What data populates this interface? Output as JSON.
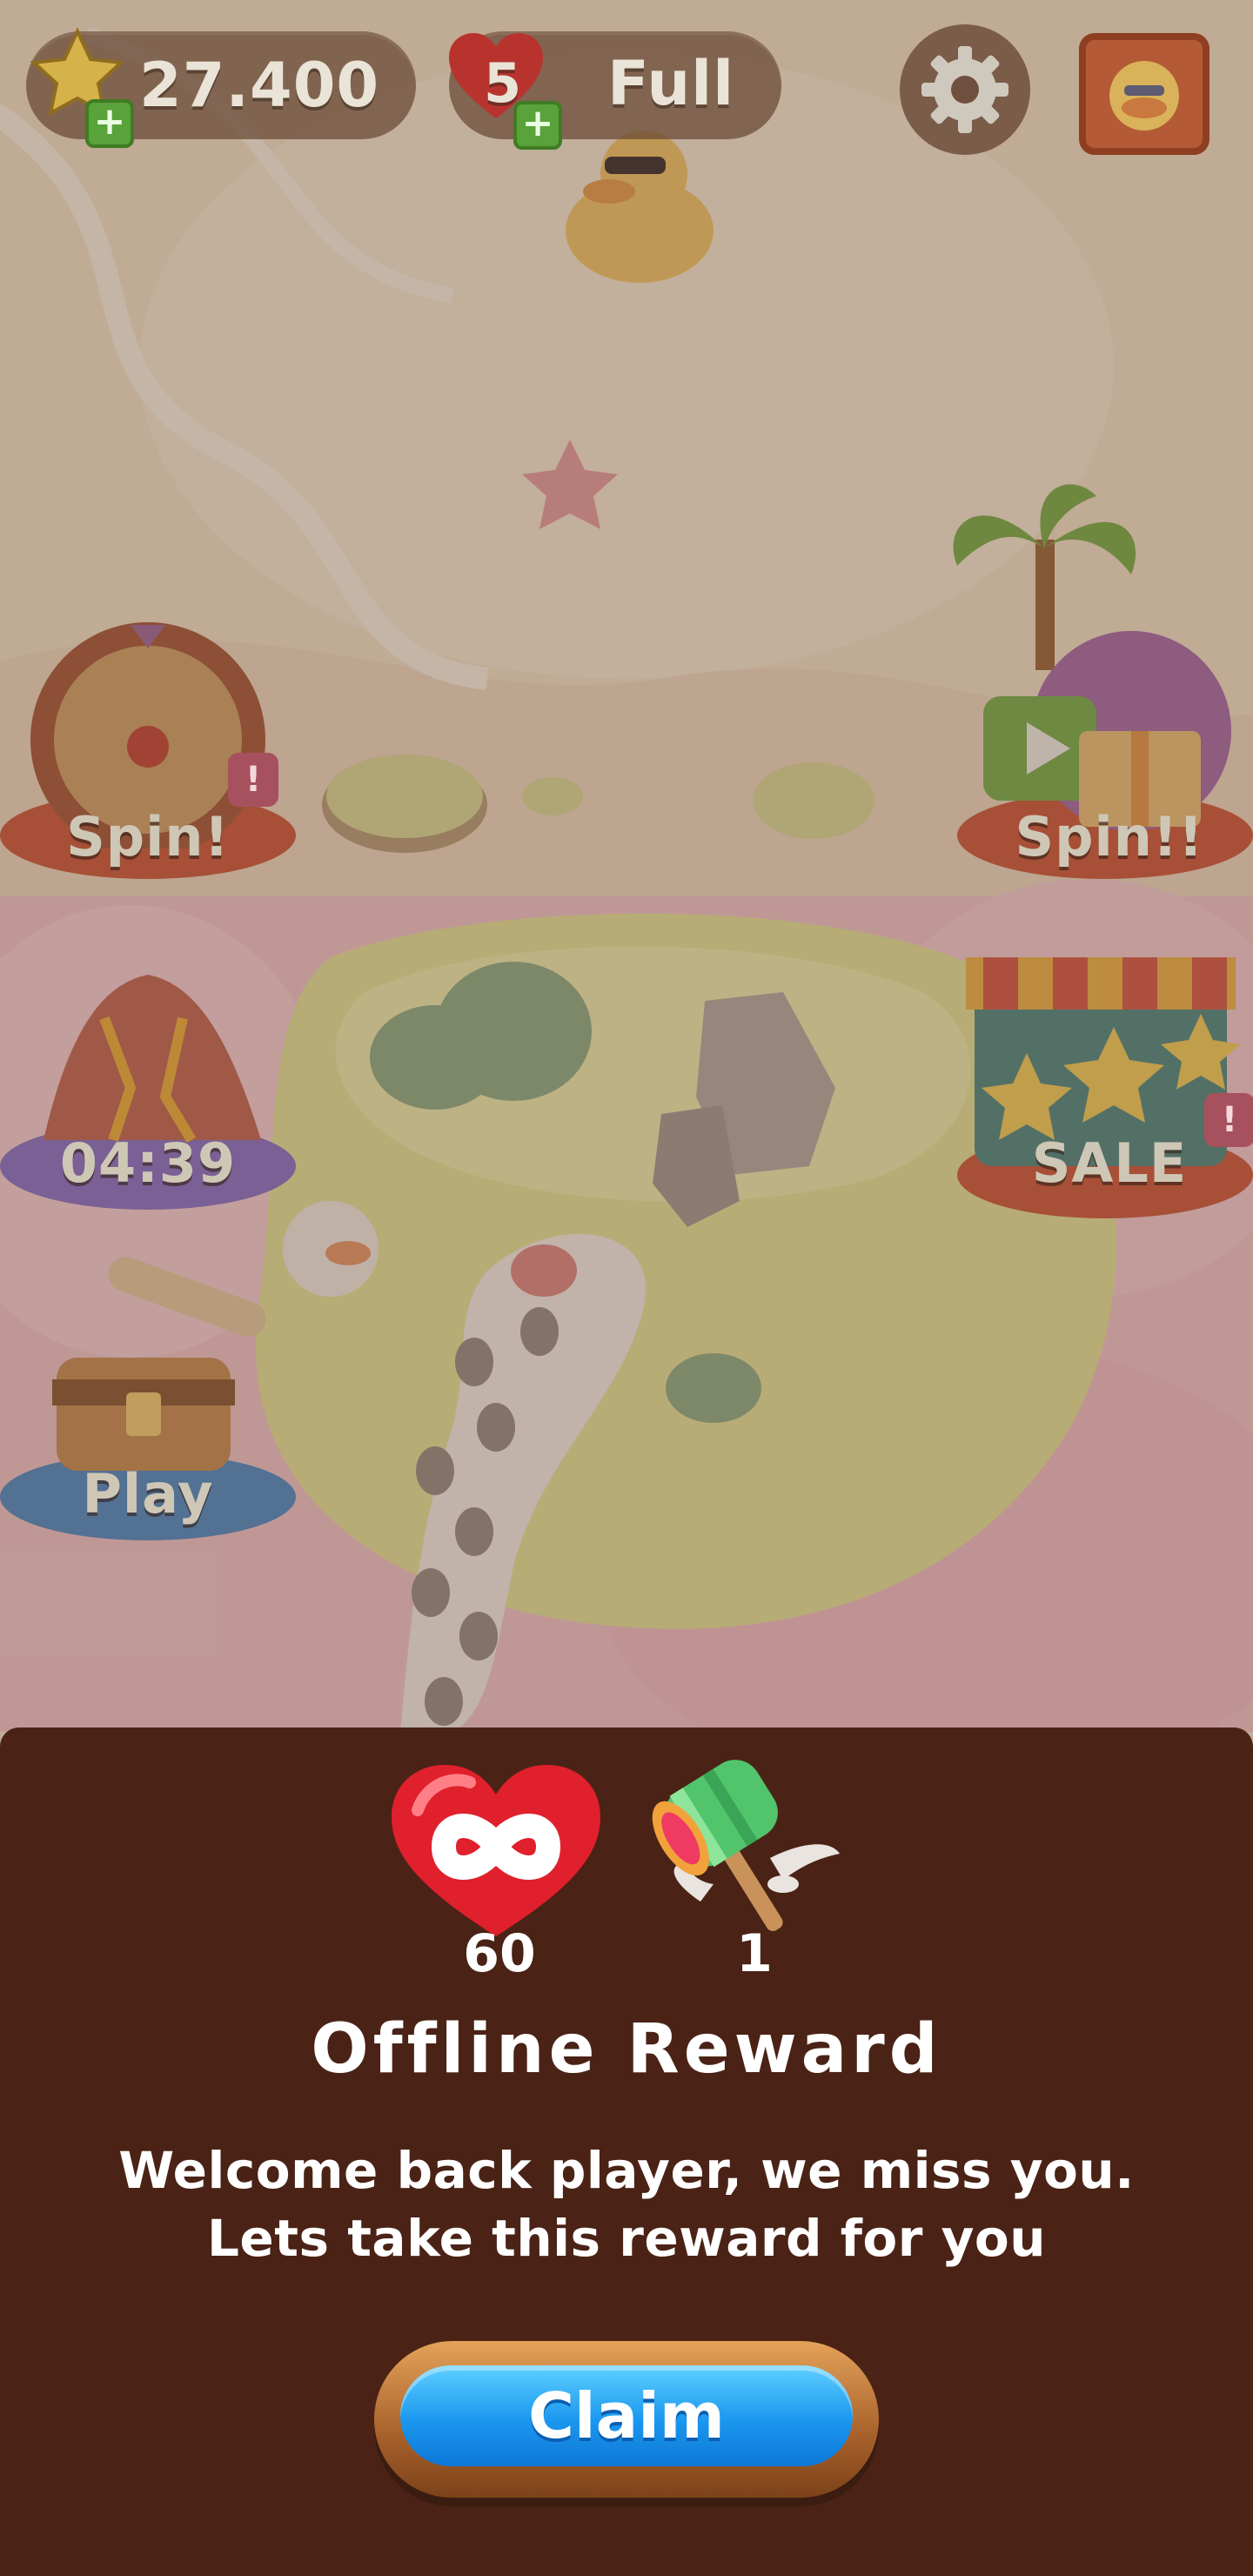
{
  "hud": {
    "stars": "27.400",
    "lives_count": "5",
    "lives_status": "Full",
    "plus_symbol": "+"
  },
  "features": {
    "spin_left": "Spin!",
    "spin_right": "Spin!!",
    "volcano_timer": "04:39",
    "sale": "SALE",
    "treasure_play": "Play",
    "notice": "!"
  },
  "reward": {
    "hearts_count": "60",
    "hammer_count": "1",
    "title": "Offline Reward",
    "message_line1": "Welcome back player, we miss you.",
    "message_line2": "Lets take this reward for you",
    "claim_label": "Claim"
  },
  "icons": [
    "star-icon",
    "heart-icon",
    "gear-icon",
    "avatar-duck-icon",
    "infinite-heart-icon",
    "winged-hammer-icon"
  ],
  "colors": {
    "sheet_bg": "#4a2316",
    "claim_blue": "#1a97ef",
    "claim_frame": "#a8612b",
    "heart_red": "#e0202c"
  }
}
